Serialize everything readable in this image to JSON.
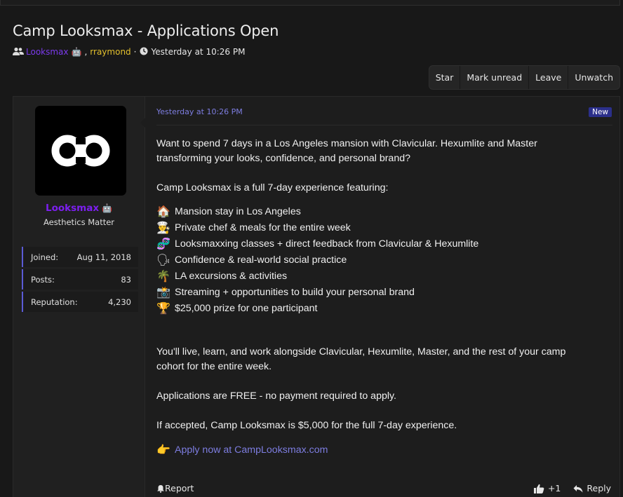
{
  "thread": {
    "title": "Camp Looksmax - Applications Open",
    "author_primary": "Looksmax",
    "author_secondary": "rraymond",
    "separator": ",",
    "dot": "·",
    "timestamp": "Yesterday at 10:26 PM"
  },
  "actions": [
    "Star",
    "Mark unread",
    "Leave",
    "Unwatch"
  ],
  "user": {
    "name": "Looksmax",
    "title": "Aesthetics Matter",
    "stats": [
      {
        "label": "Joined:",
        "value": "Aug 11, 2018"
      },
      {
        "label": "Posts:",
        "value": "83"
      },
      {
        "label": "Reputation:",
        "value": "4,230"
      }
    ]
  },
  "post": {
    "date": "Yesterday at 10:26 PM",
    "badge": "New",
    "intro": "Want to spend 7 days in a Los Angeles mansion with Clavicular. Hexumlite and Master transforming your looks, confidence, and personal brand?",
    "featuring": "Camp Looksmax is a full 7-day experience featuring:",
    "features": [
      {
        "icon": "house-icon",
        "glyph": "🏠",
        "text": "Mansion stay in Los Angeles"
      },
      {
        "icon": "chef-icon",
        "glyph": "👨‍🍳",
        "text": "Private chef & meals for the entire week"
      },
      {
        "icon": "dna-icon",
        "glyph": "🧬",
        "text": "Looksmaxxing classes + direct feedback from Clavicular & Hexumlite"
      },
      {
        "icon": "speaking-head-icon",
        "glyph": "🗣",
        "text": "Confidence & real-world social practice"
      },
      {
        "icon": "palm-tree-icon",
        "glyph": "🌴",
        "text": "LA excursions & activities"
      },
      {
        "icon": "camera-flash-icon",
        "glyph": "📸",
        "text": "Streaming + opportunities to build your personal brand"
      },
      {
        "icon": "trophy-icon",
        "glyph": "🏆",
        "text": "$25,000 prize for one participant"
      }
    ],
    "live": "You'll live, learn, and work alongside Clavicular, Hexumlite, Master, and the rest of your camp cohort for the entire week.",
    "free": "Applications are FREE - no payment required to apply.",
    "price": "If accepted, Camp Looksmax is $5,000 for the full 7-day experience.",
    "apply_icon": "👉",
    "apply": "Apply now at CampLooksmax.com",
    "report": "Report",
    "likes": "+1",
    "reply": "Reply"
  }
}
